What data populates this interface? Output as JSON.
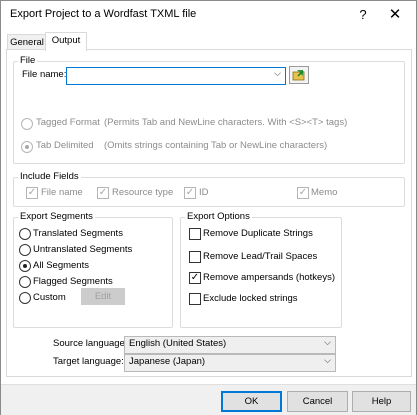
{
  "window": {
    "title": "Export Project to a Wordfast TXML file",
    "help_glyph": "?",
    "close_glyph": "✕"
  },
  "tabs": [
    {
      "label": "General",
      "active": false
    },
    {
      "label": "Output",
      "active": true
    }
  ],
  "file": {
    "group_label": "File",
    "file_name_label": "File name:",
    "file_name_value": "",
    "browse_icon": "folder-arrow-icon",
    "tagged_format": "Tagged Format",
    "tagged_format_desc": "(Permits Tab and NewLine characters. With <S><T> tags)",
    "tab_delimited": "Tab Delimited",
    "tab_delimited_desc": "(Omits strings containing Tab or NewLine characters)",
    "selected": "tab_delimited"
  },
  "include_fields": {
    "group_label": "Include Fields",
    "items": [
      {
        "label": "File name",
        "checked": true
      },
      {
        "label": "Resource type",
        "checked": true
      },
      {
        "label": "ID",
        "checked": true
      },
      {
        "label": "Memo",
        "checked": true
      }
    ]
  },
  "export_segments": {
    "group_label": "Export Segments",
    "options": [
      {
        "label": "Translated Segments",
        "selected": false
      },
      {
        "label": "Untranslated Segments",
        "selected": false
      },
      {
        "label": "All Segments",
        "selected": true
      },
      {
        "label": "Flagged Segments",
        "selected": false
      },
      {
        "label": "Custom",
        "selected": false
      }
    ],
    "edit_label": "Edit"
  },
  "export_options": {
    "group_label": "Export Options",
    "items": [
      {
        "label": "Remove Duplicate Strings",
        "checked": false
      },
      {
        "label": "Remove Lead/Trail Spaces",
        "checked": false
      },
      {
        "label": "Remove ampersands (hotkeys)",
        "checked": true
      },
      {
        "label": "Exclude locked strings",
        "checked": false
      }
    ]
  },
  "languages": {
    "source_label": "Source language:",
    "source_value": "English (United States)",
    "target_label": "Target language:",
    "target_value": "Japanese (Japan)"
  },
  "buttons": {
    "ok": "OK",
    "cancel": "Cancel",
    "help": "Help"
  },
  "colors": {
    "accent": "#0078d7",
    "browse_icon_green": "#2e9d3a"
  }
}
